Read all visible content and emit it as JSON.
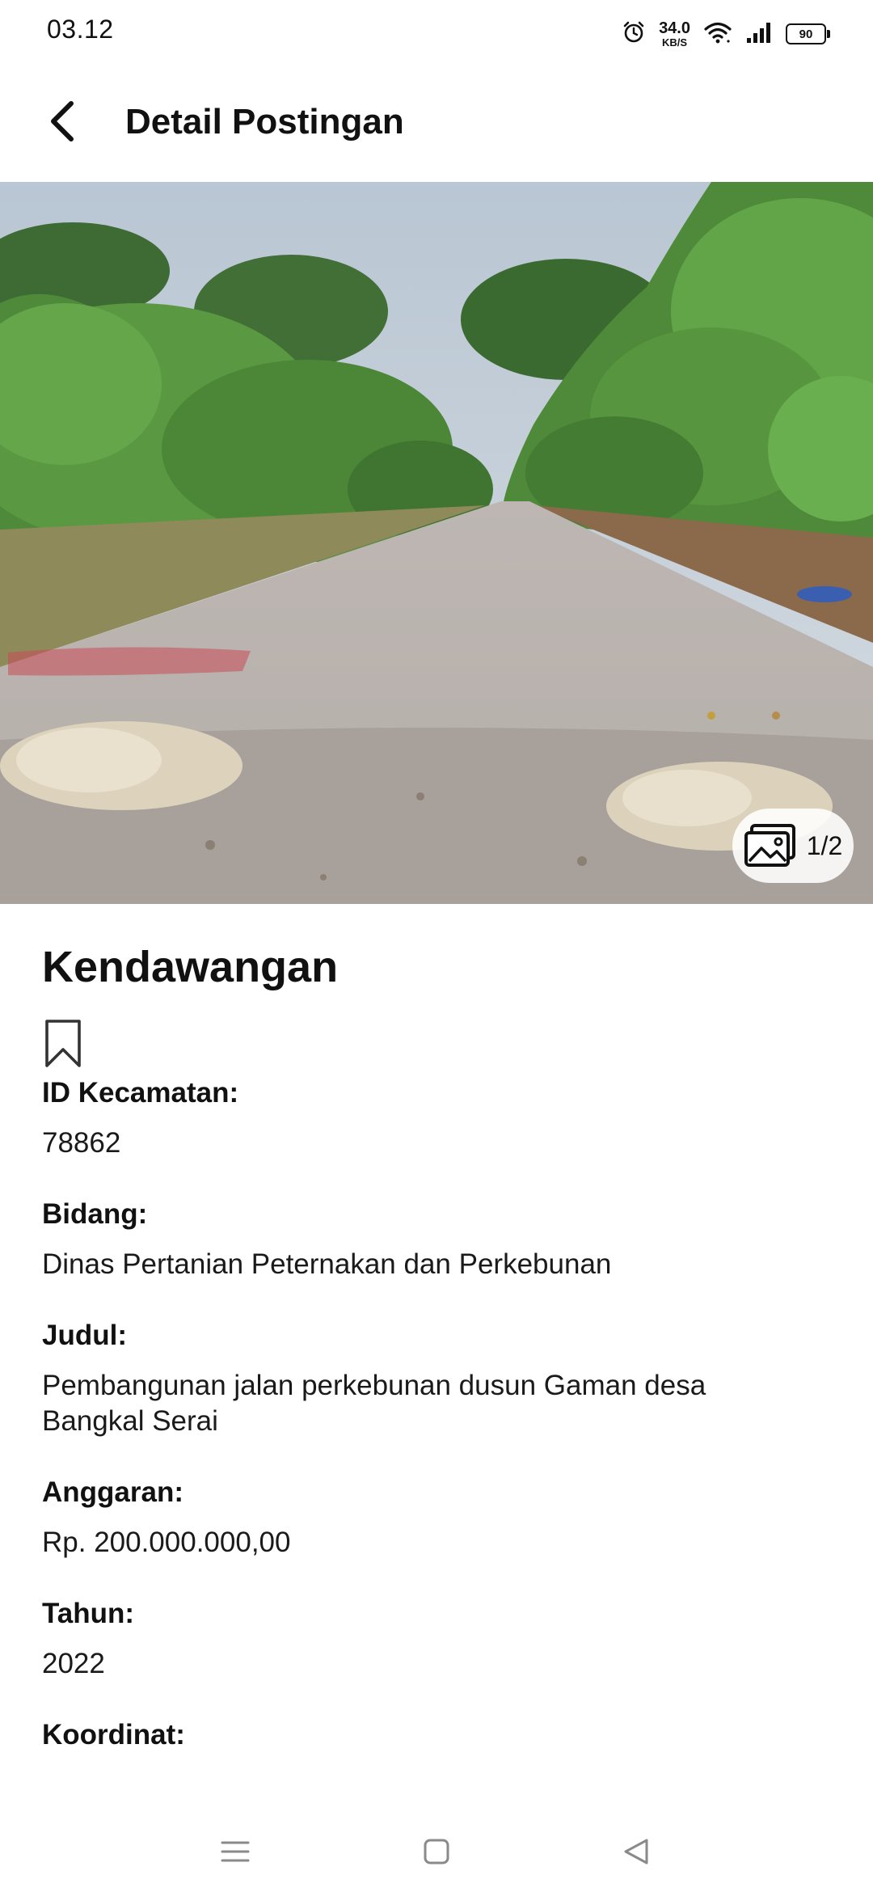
{
  "status_bar": {
    "time": "03.12",
    "net_speed_value": "34.0",
    "net_speed_unit": "KB/S",
    "battery_level": "90",
    "icons": [
      "alarm-icon",
      "wifi-icon",
      "signal-icon",
      "battery-icon"
    ]
  },
  "app_bar": {
    "title": "Detail Postingan",
    "back_icon": "back-arrow-icon"
  },
  "hero": {
    "counter": "1/2",
    "gallery_icon": "gallery-icon"
  },
  "post": {
    "location": "Kendawangan",
    "bookmark_icon": "bookmark-outline-icon",
    "fields": [
      {
        "label": "ID Kecamatan:",
        "value": "78862"
      },
      {
        "label": "Bidang:",
        "value": "Dinas Pertanian Peternakan dan Perkebunan"
      },
      {
        "label": "Judul:",
        "value": "Pembangunan jalan perkebunan dusun Gaman desa Bangkal Serai"
      },
      {
        "label": "Anggaran:",
        "value": "Rp. 200.000.000,00"
      },
      {
        "label": "Tahun:",
        "value": "2022"
      },
      {
        "label": "Koordinat:",
        "value": ""
      }
    ]
  },
  "nav_bar": {
    "items": [
      "menu-icon",
      "home-icon",
      "back-triangle-icon"
    ]
  }
}
